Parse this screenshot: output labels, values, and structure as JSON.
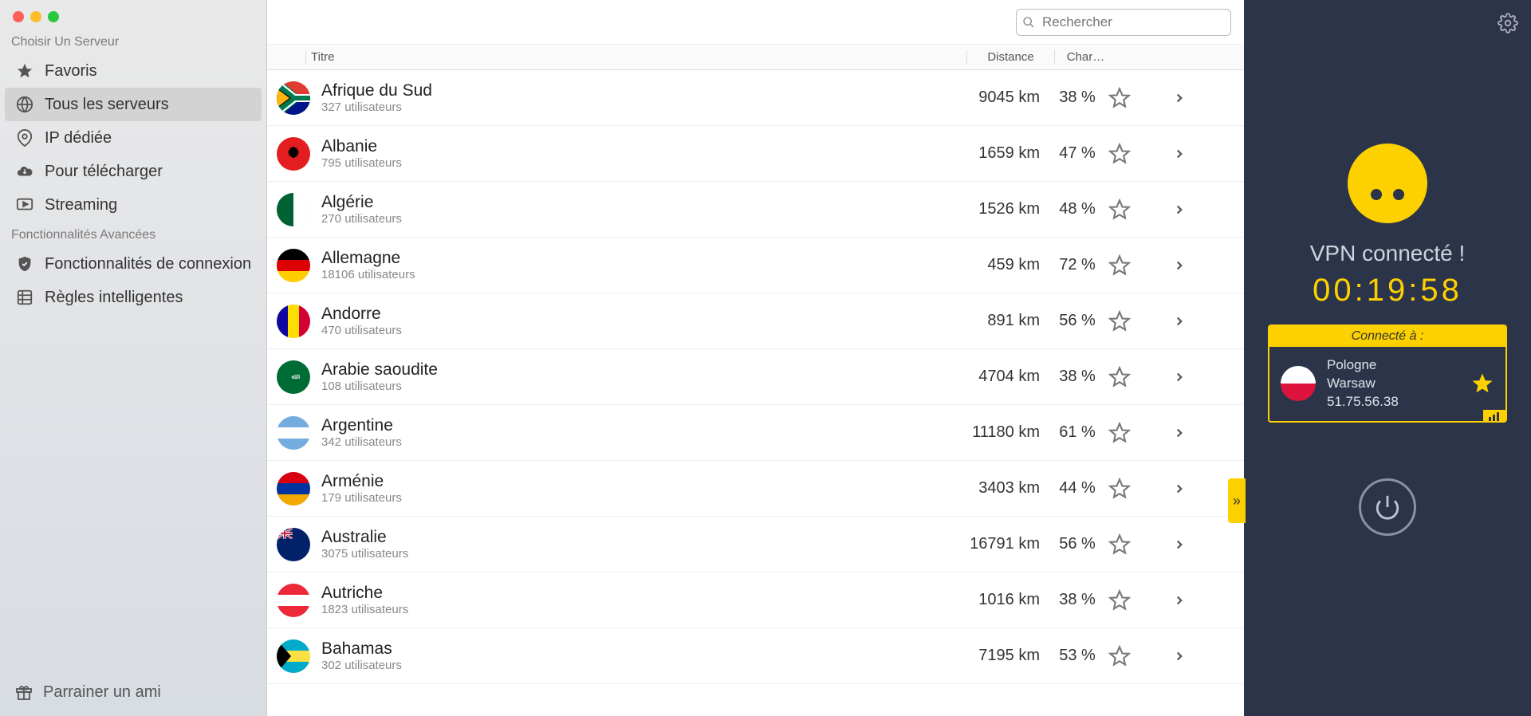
{
  "sidebar": {
    "header1": "Choisir Un Serveur",
    "header2": "Fonctionnalités Avancées",
    "items1": [
      {
        "label": "Favoris",
        "icon": "star"
      },
      {
        "label": "Tous les serveurs",
        "icon": "globe",
        "selected": true
      },
      {
        "label": "IP dédiée",
        "icon": "pin"
      },
      {
        "label": "Pour télécharger",
        "icon": "cloud"
      },
      {
        "label": "Streaming",
        "icon": "play"
      }
    ],
    "items2": [
      {
        "label": "Fonctionnalités de connexion",
        "icon": "shield"
      },
      {
        "label": "Règles intelligentes",
        "icon": "grid"
      }
    ],
    "referral": "Parrainer un ami"
  },
  "search": {
    "placeholder": "Rechercher"
  },
  "columns": {
    "title": "Titre",
    "distance": "Distance",
    "load": "Char…"
  },
  "users_suffix": "utilisateurs",
  "servers": [
    {
      "name": "Afrique du Sud",
      "users": 327,
      "distance": "9045 km",
      "load": "38 %",
      "flag": "za"
    },
    {
      "name": "Albanie",
      "users": 795,
      "distance": "1659 km",
      "load": "47 %",
      "flag": "al"
    },
    {
      "name": "Algérie",
      "users": 270,
      "distance": "1526 km",
      "load": "48 %",
      "flag": "dz"
    },
    {
      "name": "Allemagne",
      "users": 18106,
      "distance": "459 km",
      "load": "72 %",
      "flag": "de"
    },
    {
      "name": "Andorre",
      "users": 470,
      "distance": "891 km",
      "load": "56 %",
      "flag": "ad"
    },
    {
      "name": "Arabie saoudite",
      "users": 108,
      "distance": "4704 km",
      "load": "38 %",
      "flag": "sa"
    },
    {
      "name": "Argentine",
      "users": 342,
      "distance": "11180 km",
      "load": "61 %",
      "flag": "ar"
    },
    {
      "name": "Arménie",
      "users": 179,
      "distance": "3403 km",
      "load": "44 %",
      "flag": "am"
    },
    {
      "name": "Australie",
      "users": 3075,
      "distance": "16791 km",
      "load": "56 %",
      "flag": "au"
    },
    {
      "name": "Autriche",
      "users": 1823,
      "distance": "1016 km",
      "load": "38 %",
      "flag": "at"
    },
    {
      "name": "Bahamas",
      "users": 302,
      "distance": "7195 km",
      "load": "53 %",
      "flag": "bs"
    }
  ],
  "right": {
    "status": "VPN connecté !",
    "timer": "00:19:58",
    "connected_header": "Connecté à :",
    "country": "Pologne",
    "city": "Warsaw",
    "ip": "51.75.56.38"
  }
}
